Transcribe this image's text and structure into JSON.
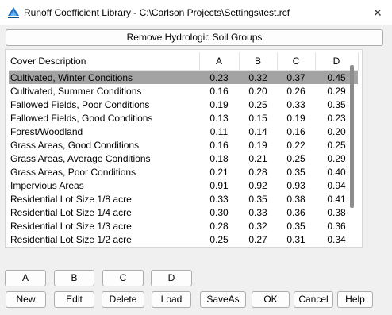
{
  "window": {
    "title": "Runoff Coefficient Library - C:\\Carlson Projects\\Settings\\test.rcf",
    "close_glyph": "✕"
  },
  "remove_button": "Remove Hydrologic Soil Groups",
  "table": {
    "headers": [
      "Cover Description",
      "A",
      "B",
      "C",
      "D"
    ],
    "rows": [
      [
        "Cultivated, Winter Concitions",
        "0.23",
        "0.32",
        "0.37",
        "0.45"
      ],
      [
        "Cultivated, Summer Conditions",
        "0.16",
        "0.20",
        "0.26",
        "0.29"
      ],
      [
        "Fallowed Fields, Poor Conditions",
        "0.19",
        "0.25",
        "0.33",
        "0.35"
      ],
      [
        "Fallowed Fields, Good Conditions",
        "0.13",
        "0.15",
        "0.19",
        "0.23"
      ],
      [
        "Forest/Woodland",
        "0.11",
        "0.14",
        "0.16",
        "0.20"
      ],
      [
        "Grass Areas, Good Conditions",
        "0.16",
        "0.19",
        "0.22",
        "0.25"
      ],
      [
        "Grass Areas, Average Conditions",
        "0.18",
        "0.21",
        "0.25",
        "0.29"
      ],
      [
        "Grass Areas, Poor Conditions",
        "0.21",
        "0.28",
        "0.35",
        "0.40"
      ],
      [
        "Impervious Areas",
        "0.91",
        "0.92",
        "0.93",
        "0.94"
      ],
      [
        "Residential Lot Size 1/8 acre",
        "0.33",
        "0.35",
        "0.38",
        "0.41"
      ],
      [
        "Residential Lot Size 1/4 acre",
        "0.30",
        "0.33",
        "0.36",
        "0.38"
      ],
      [
        "Residential Lot Size 1/3 acre",
        "0.28",
        "0.32",
        "0.35",
        "0.36"
      ],
      [
        "Residential Lot Size 1/2 acre",
        "0.25",
        "0.27",
        "0.31",
        "0.34"
      ]
    ]
  },
  "group_buttons": [
    "A",
    "B",
    "C",
    "D"
  ],
  "action_buttons": [
    "New",
    "Edit",
    "Delete",
    "Load",
    "SaveAs",
    "OK",
    "Cancel",
    "Help"
  ]
}
